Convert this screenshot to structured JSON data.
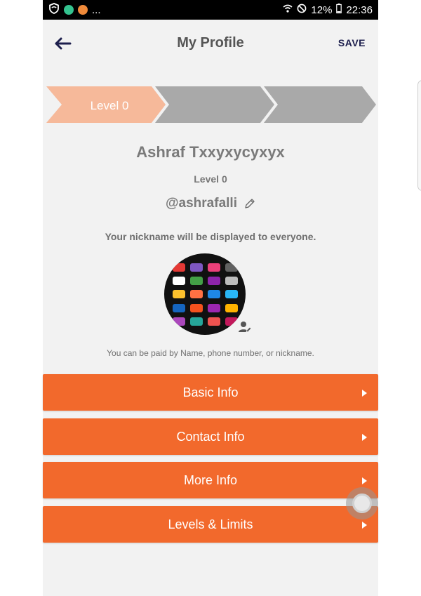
{
  "status_bar": {
    "notifications_more": "...",
    "battery": "12%",
    "time": "22:36"
  },
  "header": {
    "title": "My Profile",
    "save_label": "SAVE"
  },
  "levels": {
    "current_label": "Level 0",
    "colors": {
      "active": "#f6b99a",
      "inactive": "#a9a9a9"
    }
  },
  "profile": {
    "name": "Ashraf Txxyxycyxyx",
    "level": "Level 0",
    "handle": "@ashrafalli",
    "nickname_note": "Your nickname will be displayed to everyone.",
    "paid_note": "You can be paid by Name, phone number, or nickname."
  },
  "menu": [
    {
      "label": "Basic Info"
    },
    {
      "label": "Contact Info"
    },
    {
      "label": "More Info"
    },
    {
      "label": "Levels & Limits"
    }
  ],
  "theme": {
    "accent": "#f2692c",
    "background": "#f2f2f2",
    "title_color": "#555555"
  }
}
